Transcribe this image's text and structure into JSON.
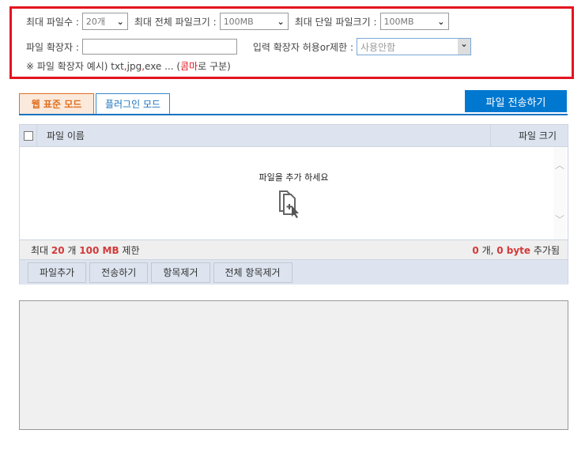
{
  "options": {
    "max_files_label": "최대 파일수 :",
    "max_files_value": "20개",
    "max_total_label": "최대 전체 파일크기 :",
    "max_total_value": "100MB",
    "max_single_label": "최대 단일 파일크기 :",
    "max_single_value": "100MB",
    "ext_label": "파일 확장자 :",
    "ext_value": "",
    "ext_mode_label": "입력 확장자 허용or제한 :",
    "ext_mode_value": "사용안함",
    "note_prefix": "※ 파일 확장자 예시) txt",
    "note_c1": ",",
    "note_jpg": "jpg",
    "note_c2": ",",
    "note_exe": "exe ... (",
    "note_comma": "콤마",
    "note_suffix": " 로 구분)"
  },
  "tabs": [
    {
      "label": "웹 표준 모드",
      "active": true
    },
    {
      "label": "플러그인 모드",
      "active": false
    }
  ],
  "send_button": "파일 전송하기",
  "table": {
    "col_name": "파일 이름",
    "col_size": "파일 크기",
    "empty_text": "파일을 추가 하세요",
    "footer_left": {
      "pre": "최대 ",
      "count": "20",
      "mid": " 개 ",
      "size": "100 MB",
      "post": " 제한"
    },
    "footer_right": {
      "count": "0",
      "mid": " 개, ",
      "bytes": "0 byte",
      "post": " 추가됨"
    }
  },
  "buttons": [
    "파일추가",
    "전송하기",
    "항목제거",
    "전체 항목제거"
  ],
  "colors": {
    "accent": "#0078d0",
    "highlight": "#e3141e",
    "active_tab": "#e07020"
  }
}
